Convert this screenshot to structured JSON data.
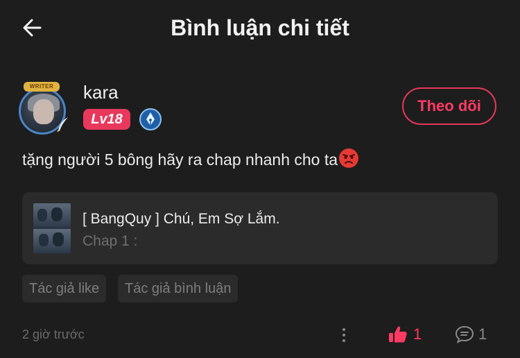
{
  "header": {
    "title": "Bình luận chi tiết"
  },
  "user": {
    "name": "kara",
    "level": "Lv18",
    "avatar_frame_label": "WRITER",
    "follow_label": "Theo dõi"
  },
  "comment": {
    "text": "tặng người 5 bông hãy ra chap nhanh cho ta",
    "emoji": "angry-face-icon"
  },
  "story_card": {
    "title": "[ BangQuy ] Chú, Em Sợ Lắm.",
    "chapter": "Chap 1 :"
  },
  "tags": [
    "Tác giả like",
    "Tác giả bình luận"
  ],
  "footer": {
    "time": "2 giờ trước",
    "like_count": "1",
    "reply_count": "1"
  },
  "colors": {
    "background": "#1d1d1d",
    "accent": "#e8395d",
    "card": "#2b2b2b"
  }
}
